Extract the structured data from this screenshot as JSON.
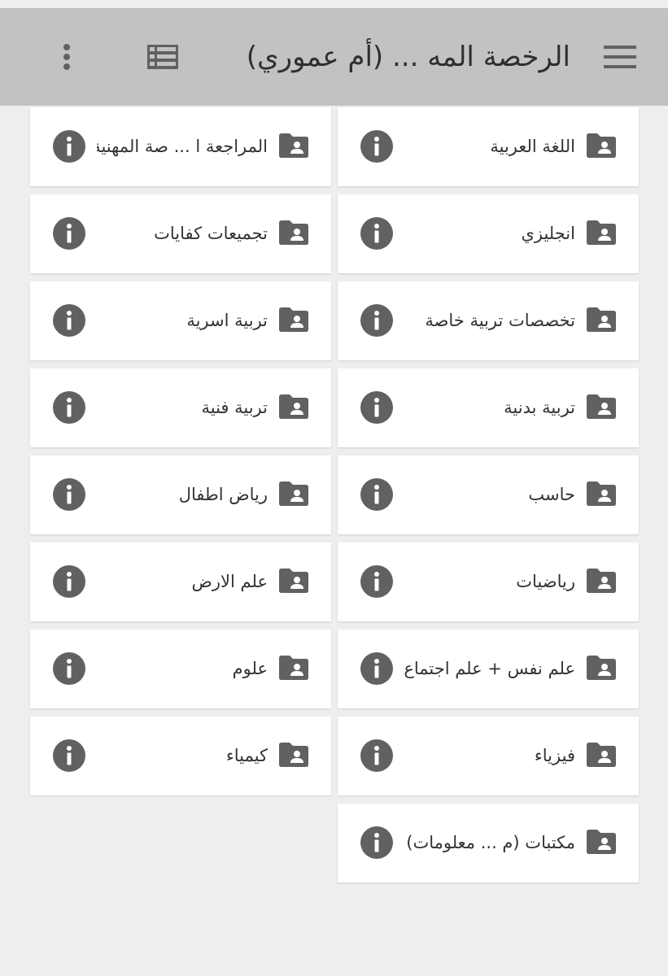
{
  "colors": {
    "app_bar_bg": "#c2c2c2",
    "page_bg": "#eeeeee",
    "card_bg": "#ffffff",
    "icon": "#616161",
    "text": "#333333"
  },
  "app_bar": {
    "title": "الرخصة الم‍ه ... (أم عموري)",
    "menu_icon": "hamburger-menu-icon",
    "list_view_icon": "list-view-icon",
    "more_icon": "more-vertical-icon"
  },
  "folders": [
    {
      "label": "اللغة العربية",
      "icon": "shared-folder-icon"
    },
    {
      "label": "المراجعة ا ... صة المهنية",
      "icon": "shared-folder-icon"
    },
    {
      "label": "انجليزي",
      "icon": "shared-folder-icon"
    },
    {
      "label": "تجميعات كفايات",
      "icon": "shared-folder-icon"
    },
    {
      "label": "تخصصات تربية خاصة",
      "icon": "shared-folder-icon"
    },
    {
      "label": "تربية اسرية",
      "icon": "shared-folder-icon"
    },
    {
      "label": "تربية بدنية",
      "icon": "shared-folder-icon"
    },
    {
      "label": "تربية فنية",
      "icon": "shared-folder-icon"
    },
    {
      "label": "حاسب",
      "icon": "shared-folder-icon"
    },
    {
      "label": "رياض اطفال",
      "icon": "shared-folder-icon"
    },
    {
      "label": "رياضيات",
      "icon": "shared-folder-icon"
    },
    {
      "label": "علم الارض",
      "icon": "shared-folder-icon"
    },
    {
      "label": "علم نفس + علم اجتماع",
      "icon": "shared-folder-icon"
    },
    {
      "label": "علوم",
      "icon": "shared-folder-icon"
    },
    {
      "label": "فيزياء",
      "icon": "shared-folder-icon"
    },
    {
      "label": "كيمياء",
      "icon": "shared-folder-icon"
    },
    {
      "label": "مكتبات (م ... معلومات)",
      "icon": "shared-folder-icon"
    }
  ],
  "info_icon": "info-icon"
}
